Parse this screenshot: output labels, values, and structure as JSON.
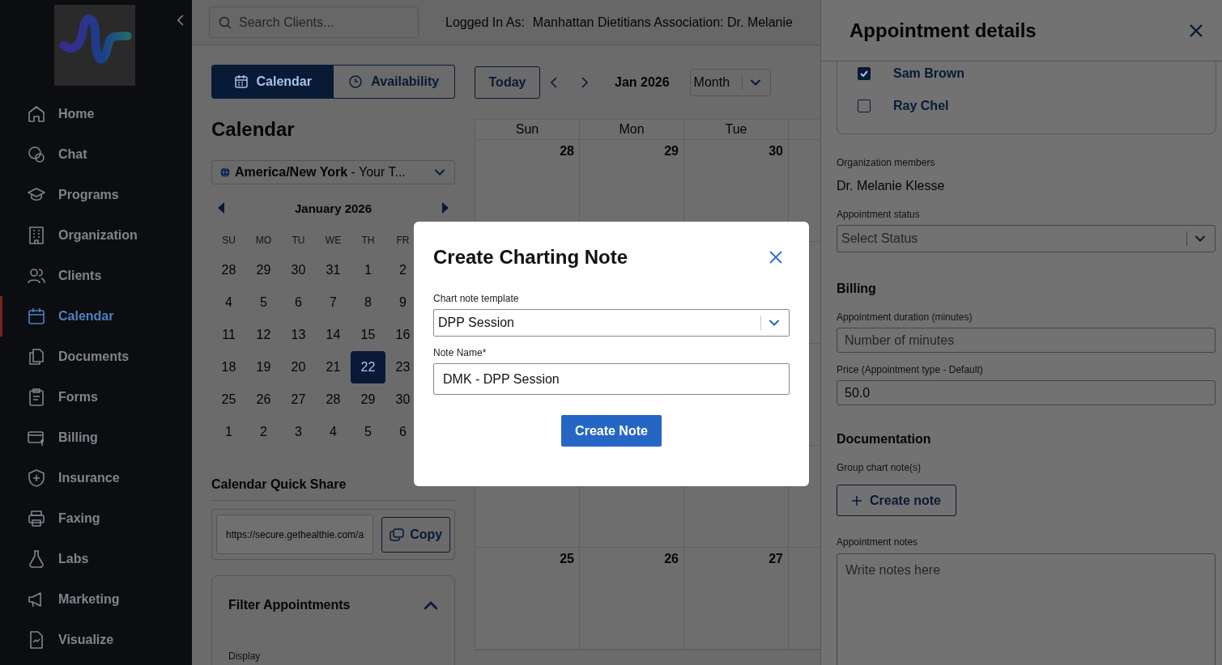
{
  "sidebar": {
    "items": [
      {
        "label": "Home",
        "selected": false
      },
      {
        "label": "Chat",
        "selected": false
      },
      {
        "label": "Programs",
        "selected": false
      },
      {
        "label": "Organization",
        "selected": false
      },
      {
        "label": "Clients",
        "selected": false
      },
      {
        "label": "Calendar",
        "selected": true
      },
      {
        "label": "Documents",
        "selected": false
      },
      {
        "label": "Forms",
        "selected": false
      },
      {
        "label": "Billing",
        "selected": false
      },
      {
        "label": "Insurance",
        "selected": false
      },
      {
        "label": "Faxing",
        "selected": false
      },
      {
        "label": "Labs",
        "selected": false
      },
      {
        "label": "Marketing",
        "selected": false
      },
      {
        "label": "Visualize",
        "selected": false
      }
    ]
  },
  "header": {
    "search": {
      "placeholder": "Search Clients..."
    },
    "logged_in_label": "Logged In As:",
    "logged_in_value": "Manhattan Dietitians Association: Dr. Melanie"
  },
  "view_tabs": [
    {
      "label": "Calendar",
      "selected": true
    },
    {
      "label": "Availability",
      "selected": false
    }
  ],
  "calendar_heading": "Calendar",
  "timezone": "**America/New York** - Your T...",
  "mini_calendar": {
    "title": "January 2026",
    "weekdays": [
      "SU",
      "MO",
      "TU",
      "WE",
      "TH",
      "FR"
    ],
    "weeks": [
      [
        {
          "day": "28",
          "selected": false
        },
        {
          "day": "29",
          "selected": false
        },
        {
          "day": "30",
          "selected": false
        },
        {
          "day": "31",
          "selected": false
        },
        {
          "day": "1",
          "selected": false
        },
        {
          "day": "2",
          "selected": false
        }
      ],
      [
        {
          "day": "4",
          "selected": false
        },
        {
          "day": "5",
          "selected": false
        },
        {
          "day": "6",
          "selected": false
        },
        {
          "day": "7",
          "selected": false
        },
        {
          "day": "8",
          "selected": false
        },
        {
          "day": "9",
          "selected": false
        }
      ],
      [
        {
          "day": "11",
          "selected": false
        },
        {
          "day": "12",
          "selected": false
        },
        {
          "day": "13",
          "selected": false
        },
        {
          "day": "14",
          "selected": false
        },
        {
          "day": "15",
          "selected": false
        },
        {
          "day": "16",
          "selected": false
        }
      ],
      [
        {
          "day": "18",
          "selected": false
        },
        {
          "day": "19",
          "selected": false
        },
        {
          "day": "20",
          "selected": false
        },
        {
          "day": "21",
          "selected": false
        },
        {
          "day": "22",
          "selected": true
        },
        {
          "day": "23",
          "selected": false
        }
      ],
      [
        {
          "day": "25",
          "selected": false
        },
        {
          "day": "26",
          "selected": false
        },
        {
          "day": "27",
          "selected": false
        },
        {
          "day": "28",
          "selected": false
        },
        {
          "day": "29",
          "selected": false
        },
        {
          "day": "30",
          "selected": false
        }
      ],
      [
        {
          "day": "1",
          "selected": false
        },
        {
          "day": "2",
          "selected": false
        },
        {
          "day": "3",
          "selected": false
        },
        {
          "day": "4",
          "selected": false
        },
        {
          "day": "5",
          "selected": false
        },
        {
          "day": "6",
          "selected": false
        }
      ]
    ]
  },
  "quick_share": {
    "title": "Calendar Quick Share",
    "url": "https://secure.gethealthie.com/a",
    "copy_label": "Copy"
  },
  "filter": {
    "title": "Filter Appointments",
    "expanded": true,
    "display_label": "Display"
  },
  "toolbar": {
    "today": "Today",
    "period": "Jan 2026",
    "view": "Month"
  },
  "month_grid": {
    "weekdays": [
      "Sun",
      "Mon",
      "Tue"
    ],
    "weeks": [
      [
        "28",
        "29",
        "30"
      ],
      [
        "25",
        "26",
        "27"
      ]
    ]
  },
  "details_panel": {
    "title": "Appointment details",
    "attendees": [
      {
        "name": "Sam Brown",
        "checked": true
      },
      {
        "name": "Ray Chel",
        "checked": false
      }
    ],
    "members_label": "Organization members",
    "member": "Dr. Melanie Klesse",
    "status_label": "Appointment status",
    "status_placeholder": "Select Status",
    "billing_heading": "Billing",
    "duration_label": "Appointment duration (minutes)",
    "duration_placeholder": "Number of minutes",
    "price_label": "Price (Appointment type - Default)",
    "price": "50.0",
    "documentation_heading": "Documentation",
    "chart_notes_label": "Group chart note(s)",
    "create_note_label": "Create note",
    "notes_label": "Appointment notes",
    "notes_placeholder": "Write notes here"
  },
  "modal": {
    "title": "Create Charting Note",
    "template_label": "Chart note template",
    "template": "DPP Session",
    "name_label": "Note Name*",
    "name": "DMK - DPP Session",
    "submit": "Create Note"
  }
}
